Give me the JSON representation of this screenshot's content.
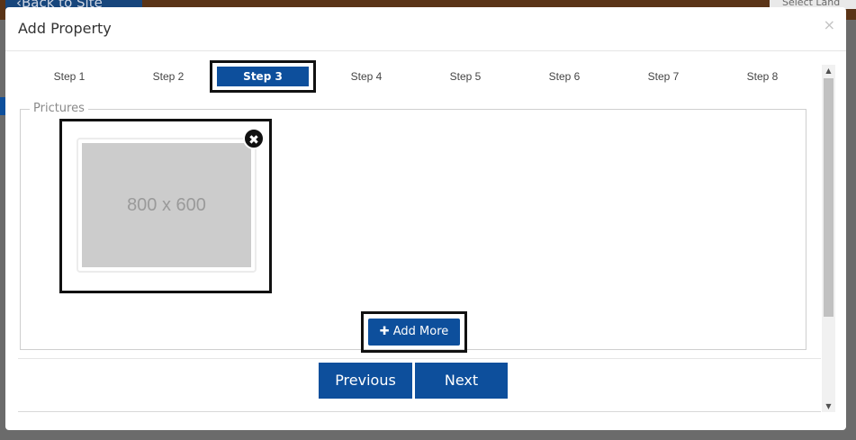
{
  "background": {
    "back_label": "‹Back to Site",
    "select_label": "Select Land"
  },
  "modal": {
    "title": "Add Property",
    "close_glyph": "×"
  },
  "steps": [
    {
      "label": "Step 1"
    },
    {
      "label": "Step 2"
    },
    {
      "label": "Step 3"
    },
    {
      "label": "Step 4"
    },
    {
      "label": "Step 5"
    },
    {
      "label": "Step 6"
    },
    {
      "label": "Step 7"
    },
    {
      "label": "Step 8"
    }
  ],
  "active_step_index": 2,
  "pictures": {
    "legend": "Prictures",
    "placeholder_text": "800 x 600",
    "remove_glyph": "✖"
  },
  "actions": {
    "add_more_label": "✚ Add More",
    "previous_label": "Previous",
    "next_label": "Next"
  },
  "colors": {
    "primary": "#0d4f9c",
    "overlay": "#6b6b6b"
  }
}
